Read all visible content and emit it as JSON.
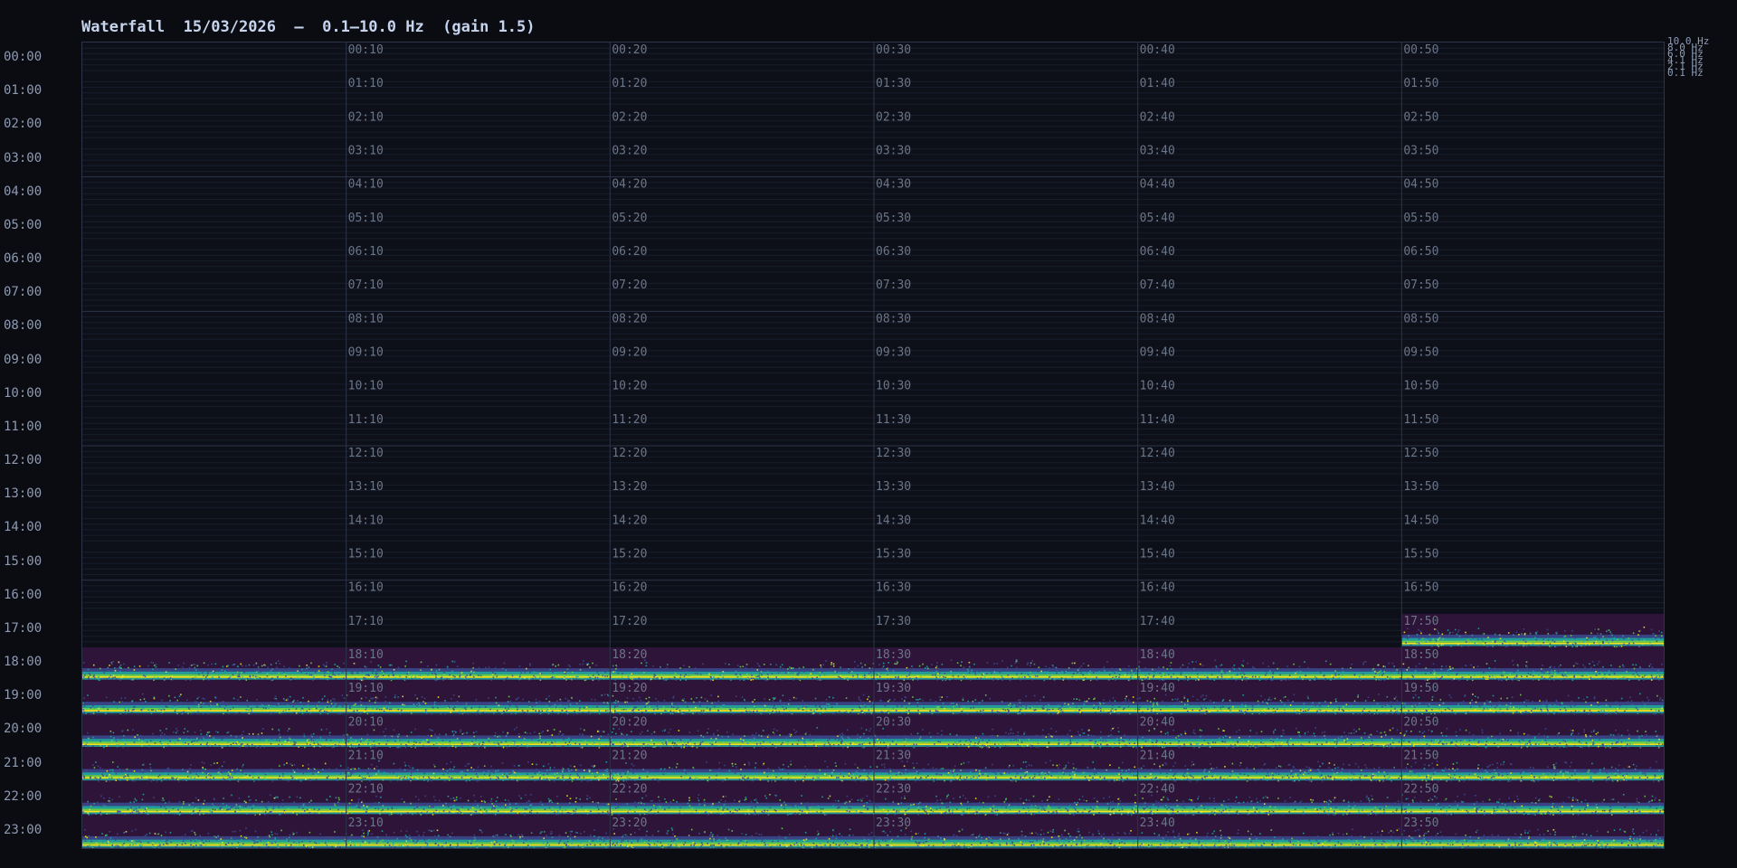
{
  "header": {
    "title": "Waterfall  15/03/2026  —  0.1–10.0 Hz  (gain 1.5)"
  },
  "chart_data": {
    "type": "heatmap",
    "title": "Waterfall  15/03/2026  —  0.1–10.0 Hz  (gain 1.5)",
    "date": "15/03/2026",
    "frequency_range_hz": [
      0.1,
      10.0
    ],
    "gain": 1.5,
    "y_axis": {
      "unit": "hour",
      "tick_labels": [
        "00:00",
        "01:00",
        "02:00",
        "03:00",
        "04:00",
        "05:00",
        "06:00",
        "07:00",
        "08:00",
        "09:00",
        "10:00",
        "11:00",
        "12:00",
        "13:00",
        "14:00",
        "15:00",
        "16:00",
        "17:00",
        "18:00",
        "19:00",
        "20:00",
        "21:00",
        "22:00",
        "23:00"
      ]
    },
    "x_axis": {
      "unit": "minute",
      "range": [
        0,
        60
      ],
      "column_minutes": [
        10,
        20,
        30,
        40,
        50
      ]
    },
    "frequency_labels": [
      "10.0 Hz",
      "8.0 Hz",
      "6.0 Hz",
      "4.1 Hz",
      "2.1 Hz",
      "0.1 Hz"
    ],
    "grid": true,
    "data_start": "17:50",
    "data_end": "23:59",
    "colormap": "viridis",
    "colors": {
      "background": "#0a0c12",
      "plot_background": "#0d1019",
      "grid_major": "#2b3448",
      "grid_minor": "#171d2b",
      "no_signal": "#2e1438",
      "low": "#3b4a8f",
      "mid": "#21a4a0",
      "high": "#6ccf4c",
      "peak": "#f0e51e"
    }
  }
}
